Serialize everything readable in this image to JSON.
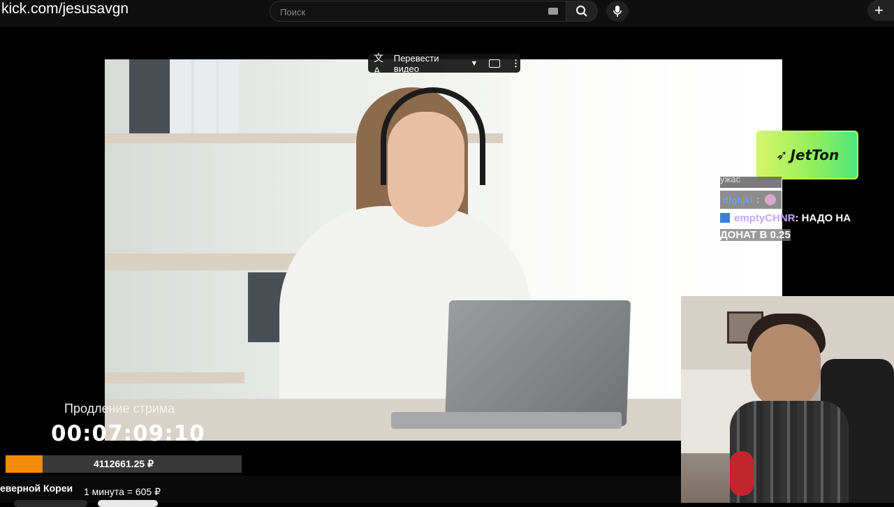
{
  "browser": {
    "channel_url": "kick.com/jesusavgn",
    "search_placeholder": "Поиск",
    "create_label": "+"
  },
  "video_overlay": {
    "translate_label": "Перевести видео"
  },
  "sponsor": {
    "logo_text": "JetTon"
  },
  "chat": {
    "cut_text": "ужас",
    "user1": "dfghjkl",
    "user1_sep": ":",
    "user2": "emptyCHNR",
    "message2_part1": ": НАДО НА",
    "message2_part2": "ДОНАТ В 0.25"
  },
  "stream_timer": {
    "title": "Продление стрима",
    "time": "00:07:09:10"
  },
  "donation_bar": {
    "amount": "4112661.25 ₽",
    "fill_fraction": 0.157
  },
  "ticker": {
    "country": "еверной Кореи",
    "rate": "1 минута = 605 ₽"
  },
  "colors": {
    "accent_orange": "#f28b0a",
    "jetton_green": "#93ef5b",
    "chat_name_purple": "#c4a6ff",
    "chat_name_blue": "#6aa0ff"
  }
}
